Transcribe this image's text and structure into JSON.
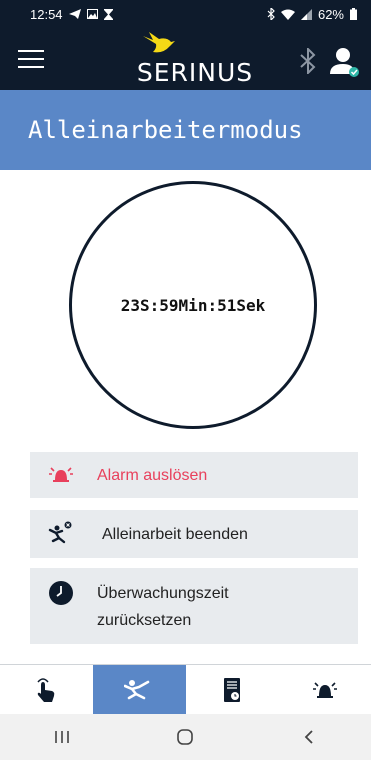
{
  "status_bar": {
    "time": "12:54",
    "battery": "62%",
    "icons": [
      "telegram-icon",
      "image-icon",
      "hourglass-icon",
      "bluetooth-icon",
      "wifi-icon",
      "signal-icon",
      "battery-icon"
    ]
  },
  "app_bar": {
    "logo_text": "SERINUS",
    "menu_icon": "hamburger-menu-icon",
    "bluetooth_icon": "bluetooth-icon",
    "user_icon": "user-verified-icon"
  },
  "page": {
    "title": "Alleinarbeitermodus"
  },
  "timer": {
    "display": "23S:59Min:51Sek"
  },
  "actions": [
    {
      "label": "Alarm auslösen",
      "icon": "alarm-bell-icon",
      "color": "#e8405c"
    },
    {
      "label": "Alleinarbeit beenden",
      "icon": "fall-person-icon",
      "color": "#222222"
    },
    {
      "label_line1": "Überwachungszeit",
      "label_line2": "zurücksetzen",
      "icon": "clock-icon",
      "color": "#222222"
    }
  ],
  "bottom_nav": [
    {
      "icon": "touch-hand-icon",
      "active": false
    },
    {
      "icon": "fall-person-icon",
      "active": true
    },
    {
      "icon": "timer-document-icon",
      "active": false
    },
    {
      "icon": "alarm-bell-icon",
      "active": false
    }
  ],
  "system_nav": [
    "recent-apps-icon",
    "home-icon",
    "back-icon"
  ],
  "colors": {
    "header_bg": "#0e1b2c",
    "accent_blue": "#5a87c7",
    "logo_yellow": "#f5d916",
    "alarm_red": "#e8405c",
    "verified_teal": "#2fb6a8"
  }
}
